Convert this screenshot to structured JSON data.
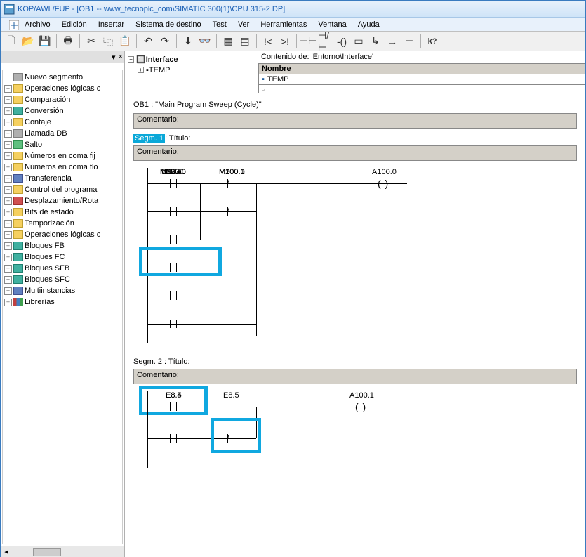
{
  "title": "KOP/AWL/FUP  - [OB1 -- www_tecnoplc_com\\SIMATIC 300(1)\\CPU 315-2 DP]",
  "menu": [
    "Archivo",
    "Edición",
    "Insertar",
    "Sistema de destino",
    "Test",
    "Ver",
    "Herramientas",
    "Ventana",
    "Ayuda"
  ],
  "sidebar_close": "×",
  "tree": [
    {
      "icon": "ico-gray",
      "label": "Nuevo segmento"
    },
    {
      "icon": "ico-yellow",
      "label": "Operaciones lógicas c"
    },
    {
      "icon": "ico-yellow",
      "label": "Comparación"
    },
    {
      "icon": "ico-teal",
      "label": "Conversión"
    },
    {
      "icon": "ico-yellow",
      "label": "Contaje"
    },
    {
      "icon": "ico-gray",
      "label": "Llamada DB"
    },
    {
      "icon": "ico-green",
      "label": "Salto"
    },
    {
      "icon": "ico-yellow",
      "label": "Números en coma fij"
    },
    {
      "icon": "ico-yellow",
      "label": "Números en coma flo"
    },
    {
      "icon": "ico-blue",
      "label": "Transferencia"
    },
    {
      "icon": "ico-yellow",
      "label": "Control del programa"
    },
    {
      "icon": "ico-red",
      "label": "Desplazamiento/Rota"
    },
    {
      "icon": "ico-yellow",
      "label": "Bits de estado"
    },
    {
      "icon": "ico-yellow",
      "label": "Temporización"
    },
    {
      "icon": "ico-yellow",
      "label": "Operaciones lógicas c"
    },
    {
      "icon": "ico-teal",
      "label": "Bloques FB"
    },
    {
      "icon": "ico-teal",
      "label": "Bloques FC"
    },
    {
      "icon": "ico-teal",
      "label": "Bloques SFB"
    },
    {
      "icon": "ico-teal",
      "label": "Bloques SFC"
    },
    {
      "icon": "ico-blue",
      "label": "Multiinstancias"
    },
    {
      "icon": "ico-books",
      "label": "Librerías"
    }
  ],
  "interface": {
    "root": "Interface",
    "child": "TEMP"
  },
  "contents": {
    "header": "Contenido de: 'Entorno\\Interface'",
    "col": "Nombre",
    "row": "TEMP"
  },
  "editor": {
    "ob": "OB1 :  \"Main Program Sweep (Cycle)\"",
    "comment": "Comentario:",
    "seg1_pre": "Segm. 1",
    "seg1_post": ": Título:",
    "seg2": "Segm. 2 : Título:",
    "c": {
      "m10": "M10.0",
      "m100": "M100.1",
      "a100": "A100.0",
      "m5": "M5.0",
      "m200": "M200.0",
      "m220": "M220.0",
      "e85": "E8.5",
      "m227": "M227.0",
      "m500": "M500.0",
      "a101": "A100.1",
      "e84": "E8.4"
    }
  }
}
